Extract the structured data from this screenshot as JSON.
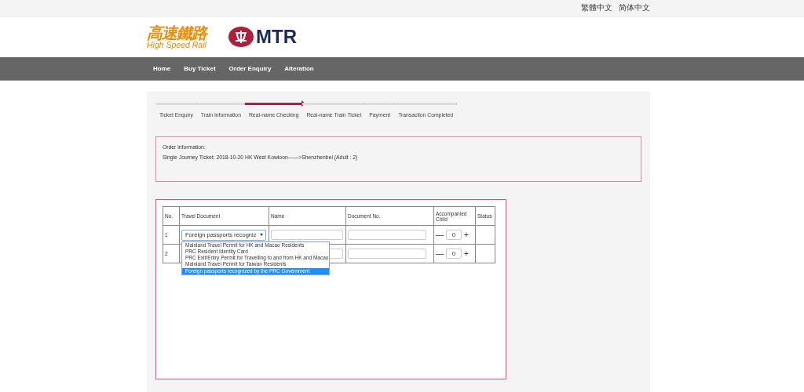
{
  "top_bar": {
    "languages": [
      "繁體中文",
      "简体中文"
    ]
  },
  "header": {
    "logo_chinese": "高速鐵路",
    "logo_english": "High Speed Rail",
    "mtr_logo": "MTR"
  },
  "nav": [
    {
      "label": "Home"
    },
    {
      "label": "Buy Ticket"
    },
    {
      "label": "Order Enquiry"
    },
    {
      "label": "Alteration"
    }
  ],
  "steps": [
    {
      "label": "Ticket Enquiry",
      "selected": false
    },
    {
      "label": "Train Information",
      "selected": false
    },
    {
      "label": "Real-name Checking",
      "selected": true
    },
    {
      "label": "Real-name Train Ticket",
      "selected": false
    },
    {
      "label": "Payment",
      "selected": false
    },
    {
      "label": "Transaction Completed",
      "selected": false
    }
  ],
  "order_info": {
    "heading": "Order information:",
    "details": "Single Journey Ticket: 2018-10-20 HK West Kowloon——>Shenzhenbei (Adult : 2)"
  },
  "table": {
    "columns": [
      "No.",
      "Travel Document",
      "Name",
      "Document No.",
      "Accompanied Child",
      "Status"
    ],
    "rows": [
      {
        "no": "1",
        "travel_document": "Foreign passports recogniz",
        "child_count": "0",
        "minus": "—",
        "plus": "+"
      },
      {
        "no": "2",
        "child_count": "0",
        "minus": "—",
        "plus": "+"
      }
    ]
  },
  "dropdown": {
    "options": [
      {
        "label": "Mainland Travel Permit for HK and Macao Residents",
        "selected": false
      },
      {
        "label": "PRC Resident Identity Card",
        "selected": false
      },
      {
        "label": "PRC Exit/Entry Permit for Travelling to and from HK and Macao",
        "selected": false
      },
      {
        "label": "Mainland Travel Permit for Taiwan Residents",
        "selected": false
      },
      {
        "label": "Foreign passports recognized by the PRC Government",
        "selected": true
      }
    ]
  }
}
